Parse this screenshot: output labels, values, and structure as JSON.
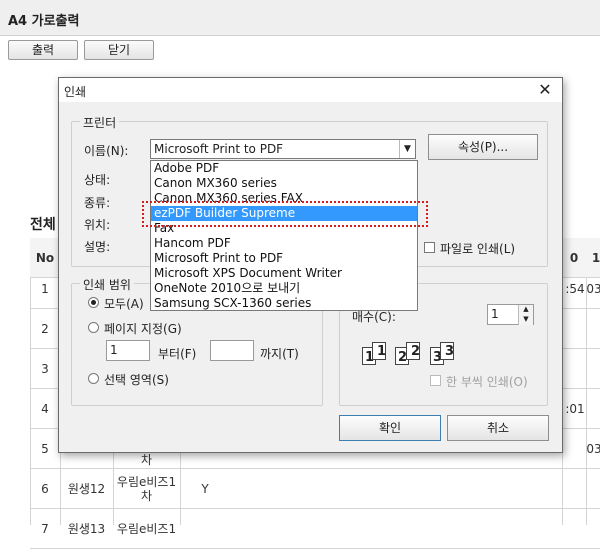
{
  "page": {
    "title": "A4 가로출력",
    "buttons": {
      "print": "출력",
      "close": "닫기"
    },
    "section_title": "전체",
    "table": {
      "header": {
        "no": "No",
        "col_o": "0",
        "col_1": "1"
      },
      "rows": [
        {
          "no": "1",
          "tail": ":54",
          "tail2": "03:"
        },
        {
          "no": "2"
        },
        {
          "no": "3"
        },
        {
          "no": "4",
          "tail": ":01"
        },
        {
          "no": "5",
          "c2": "차",
          "tail2": "03:"
        },
        {
          "no": "6",
          "c1": "원생12",
          "c2": "우림e비즈1\n차",
          "c3": "Y"
        },
        {
          "no": "7",
          "c1": "원생13",
          "c2": "우림e비즈1",
          "c3": ""
        }
      ]
    }
  },
  "dialog": {
    "title": "인쇄",
    "close_glyph": "✕",
    "printer_group": {
      "label": "프린터",
      "name_label": "이름(N):",
      "selected_printer": "Microsoft Print to PDF",
      "properties_button": "속성(P)...",
      "status_label": "상태:",
      "type_label": "종류:",
      "where_label": "위치:",
      "comment_label": "설명:",
      "print_to_file_label": "파일로 인쇄(L)",
      "dropdown_items": [
        "Adobe PDF",
        "Canon MX360 series",
        "Canon MX360 series FAX",
        "ezPDF Builder Supreme",
        "Fax",
        "Hancom PDF",
        "Microsoft Print to PDF",
        "Microsoft XPS Document Writer",
        "OneNote 2010으로 보내기",
        "Samsung SCX-1360 series"
      ],
      "highlighted_item": "ezPDF Builder Supreme"
    },
    "range_group": {
      "label": "인쇄 범위",
      "all": "모두(A)",
      "pages": "페이지 지정(G)",
      "from_value": "1",
      "from_label": "부터(F)",
      "to_value": "",
      "to_label": "까지(T)",
      "selection": "선택 영역(S)"
    },
    "copies_group": {
      "copies_label": "매수(C):",
      "copies_value": "1",
      "collate_label": "한 부씩 인쇄(O)",
      "collate_icons": [
        "1",
        "1",
        "2",
        "2",
        "3",
        "3"
      ]
    },
    "ok_button": "확인",
    "cancel_button": "취소"
  }
}
